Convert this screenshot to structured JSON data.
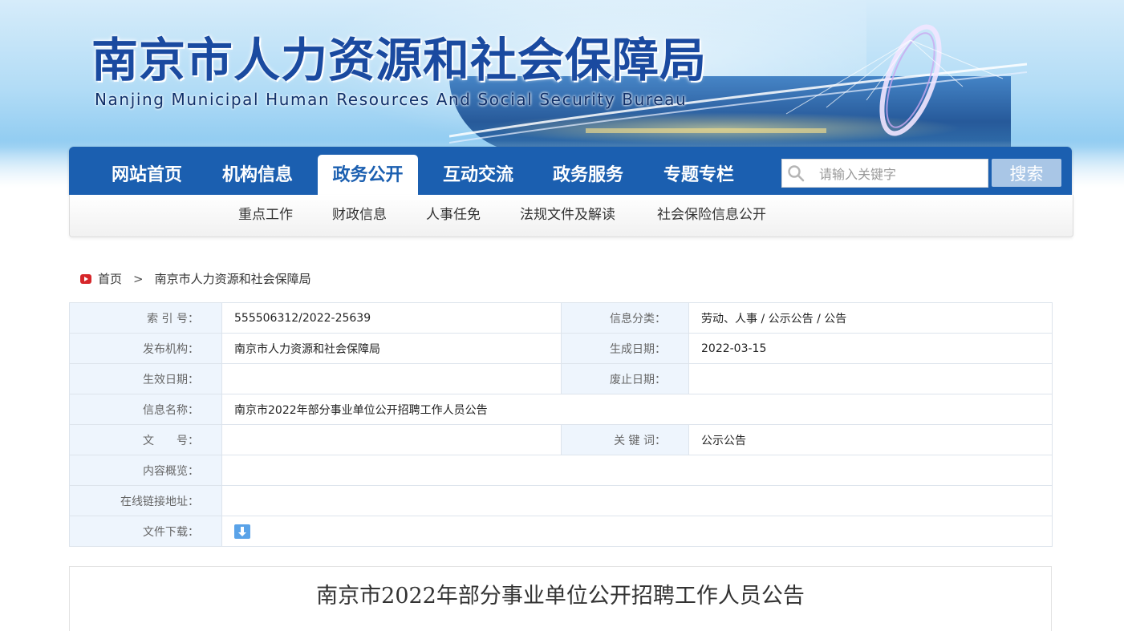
{
  "header": {
    "title": "南京市人力资源和社会保障局",
    "subtitle": "Nanjing Municipal Human Resources And Social Security Bureau"
  },
  "nav": {
    "items": [
      {
        "label": "网站首页",
        "active": false
      },
      {
        "label": "机构信息",
        "active": false
      },
      {
        "label": "政务公开",
        "active": true
      },
      {
        "label": "互动交流",
        "active": false
      },
      {
        "label": "政务服务",
        "active": false
      },
      {
        "label": "专题专栏",
        "active": false
      }
    ],
    "search_placeholder": "请输入关键字",
    "search_button": "搜索"
  },
  "subnav": {
    "items": [
      "重点工作",
      "财政信息",
      "人事任免",
      "法规文件及解读",
      "社会保险信息公开"
    ]
  },
  "breadcrumb": {
    "home": "首页",
    "current": "南京市人力资源和社会保障局"
  },
  "meta": {
    "index_no_label": "索 引 号：",
    "index_no": "555506312/2022-25639",
    "category_label": "信息分类：",
    "category": "劳动、人事 / 公示公告 / 公告",
    "publisher_label": "发布机构：",
    "publisher": "南京市人力资源和社会保障局",
    "created_label": "生成日期：",
    "created": "2022-03-15",
    "effective_label": "生效日期：",
    "effective": "",
    "expiry_label": "废止日期：",
    "expiry": "",
    "name_label": "信息名称：",
    "name": "南京市2022年部分事业单位公开招聘工作人员公告",
    "doc_no_label": "文　　号：",
    "doc_no": "",
    "keywords_label": "关 键 词：",
    "keywords": "公示公告",
    "summary_label": "内容概览：",
    "summary": "",
    "link_label": "在线链接地址：",
    "link": "",
    "download_label": "文件下载："
  },
  "article": {
    "title": "南京市2022年部分事业单位公开招聘工作人员公告"
  },
  "colors": {
    "nav_blue": "#1b5fb0",
    "title_blue": "#1a4aa0",
    "label_bg": "#eef5fd",
    "search_button_bg": "#a9c6e6"
  }
}
